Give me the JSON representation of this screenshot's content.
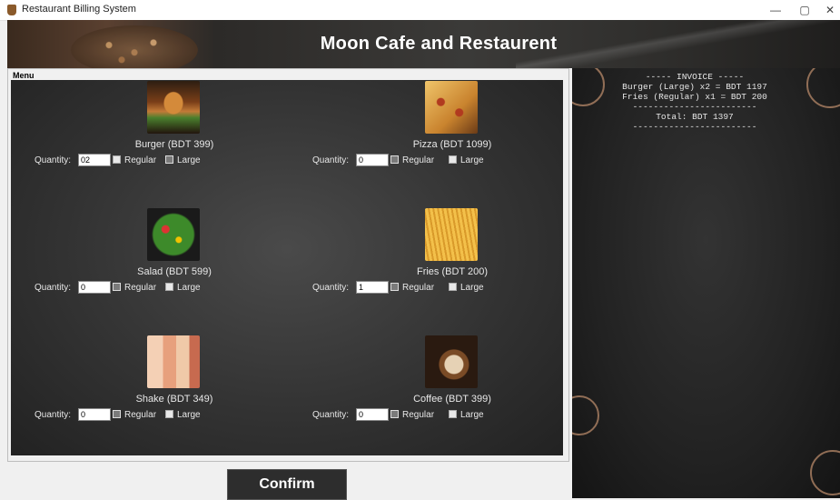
{
  "window": {
    "title": "Restaurant Billing System",
    "controls": [
      "—",
      "▢",
      "✕"
    ]
  },
  "banner": {
    "title": "Moon Cafe and Restaurent"
  },
  "menu": {
    "label": "Menu",
    "quantity_label": "Quantity:",
    "items": [
      {
        "name": "Burger (BDT 399)",
        "quantity": "02",
        "options": [
          {
            "label": "Regular",
            "selected": false
          },
          {
            "label": "Large",
            "selected": true
          }
        ]
      },
      {
        "name": "Pizza (BDT 1099)",
        "quantity": "0",
        "options": [
          {
            "label": "Regular",
            "selected": true
          },
          {
            "label": "Large",
            "selected": false
          }
        ]
      },
      {
        "name": "Salad (BDT 599)",
        "quantity": "0",
        "options": [
          {
            "label": "Regular",
            "selected": true
          },
          {
            "label": "Large",
            "selected": false
          }
        ]
      },
      {
        "name": "Fries (BDT 200)",
        "quantity": "1",
        "options": [
          {
            "label": "Regular",
            "selected": true
          },
          {
            "label": "Large",
            "selected": false
          }
        ]
      },
      {
        "name": "Shake (BDT 349)",
        "quantity": "0",
        "options": [
          {
            "label": "Regular",
            "selected": true
          },
          {
            "label": "Large",
            "selected": false
          }
        ]
      },
      {
        "name": "Coffee (BDT 399)",
        "quantity": "0",
        "options": [
          {
            "label": "Regular",
            "selected": true
          },
          {
            "label": "Large",
            "selected": false
          }
        ]
      }
    ]
  },
  "confirm_label": "Confirm",
  "invoice": {
    "lines": [
      "----- INVOICE -----",
      "Burger (Large) x2 = BDT 1197",
      "Fries (Regular) x1 = BDT 200",
      "------------------------",
      "Total: BDT 1397",
      "------------------------"
    ]
  }
}
